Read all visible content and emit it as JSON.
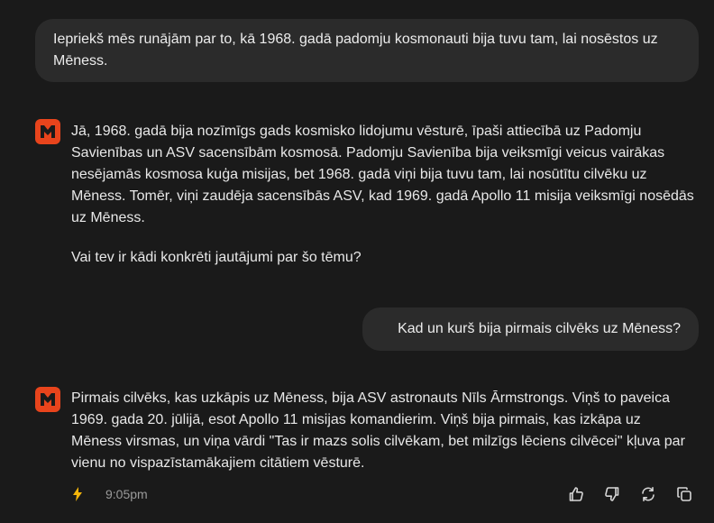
{
  "conversation": {
    "messages": [
      {
        "role": "user",
        "text": "Iepriekš mēs runājām par to, kā 1968. gadā padomju kosmonauti bija tuvu tam, lai nosēstos uz Mēness."
      },
      {
        "role": "assistant",
        "paragraphs": [
          "Jā, 1968. gadā bija nozīmīgs gads kosmisko lidojumu vēsturē, īpaši attiecībā uz Padomju Savienības un ASV sacensībām kosmosā. Padomju Savienība bija veiksmīgi veicus vairākas nesējamās kosmosa kuģa misijas, bet 1968. gadā viņi bija tuvu tam, lai nosūtītu cilvēku uz Mēness. Tomēr, viņi zaudēja sacensībās ASV, kad 1969. gadā Apollo 11 misija veiksmīgi nosēdās uz Mēness.",
          "Vai tev ir kādi konkrēti jautājumi par šo tēmu?"
        ]
      },
      {
        "role": "user",
        "text": "Kad un kurš bija pirmais cilvēks uz Mēness?"
      },
      {
        "role": "assistant",
        "paragraphs": [
          "Pirmais cilvēks, kas uzkāpis uz Mēness, bija ASV astronauts Nīls Ārmstrongs. Viņš to paveica 1969. gada 20. jūlijā, esot Apollo 11 misijas komandierim. Viņš bija pirmais, kas izkāpa uz Mēness virsmas, un viņa vārdi \"Tas ir mazs solis cilvēkam, bet milzīgs lēciens cilvēcei\" kļuva par vienu no vispazīstamākajiem citātiem vēsturē."
        ],
        "timestamp": "9:05pm"
      }
    ]
  },
  "icons": {
    "assistant_avatar": "assistant-logo-icon",
    "speed": "lightning-bolt-icon",
    "actions": [
      "thumbs-up-icon",
      "thumbs-down-icon",
      "regenerate-icon",
      "copy-icon"
    ]
  },
  "colors": {
    "background": "#1a1a1a",
    "user_bubble": "#2b2b2b",
    "avatar": "#e8441c",
    "bolt": "#f5b50a",
    "timestamp": "#9a9a9a"
  }
}
